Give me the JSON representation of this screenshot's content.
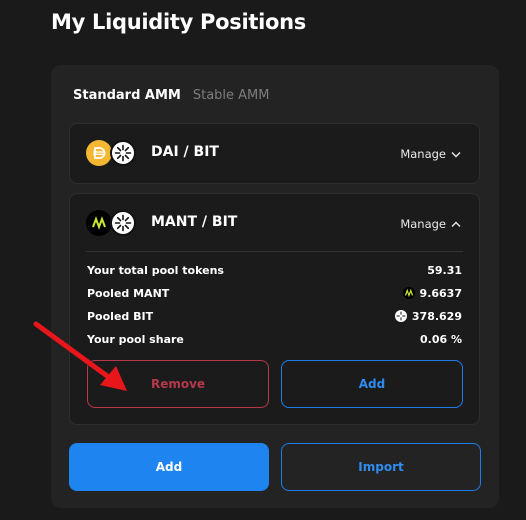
{
  "page_title": "My Liquidity Positions",
  "tabs": [
    {
      "label": "Standard AMM",
      "active": true
    },
    {
      "label": "Stable AMM",
      "active": false
    }
  ],
  "positions": [
    {
      "pair": "DAI / BIT",
      "manage_label": "Manage",
      "expanded": false,
      "token_icons": [
        "dai-icon",
        "bit-icon"
      ]
    },
    {
      "pair": "MANT / BIT",
      "manage_label": "Manage",
      "expanded": true,
      "token_icons": [
        "mant-icon",
        "bit-icon"
      ],
      "details": {
        "total_pool_tokens_label": "Your total pool tokens",
        "total_pool_tokens_value": "59.31",
        "pooled_mant_label": "Pooled MANT",
        "pooled_mant_value": "9.6637",
        "pooled_bit_label": "Pooled BIT",
        "pooled_bit_value": "378.629",
        "pool_share_label": "Your pool share",
        "pool_share_value": "0.06 %"
      },
      "remove_label": "Remove",
      "add_label": "Add"
    }
  ],
  "footer": {
    "add_label": "Add",
    "import_label": "Import"
  },
  "colors": {
    "background": "#1a1a1a",
    "panel": "#232323",
    "accent_blue": "#1e84f0",
    "remove_red": "#b5384b",
    "dai_yellow": "#f4b731",
    "annotation_arrow": "#e8161b"
  }
}
